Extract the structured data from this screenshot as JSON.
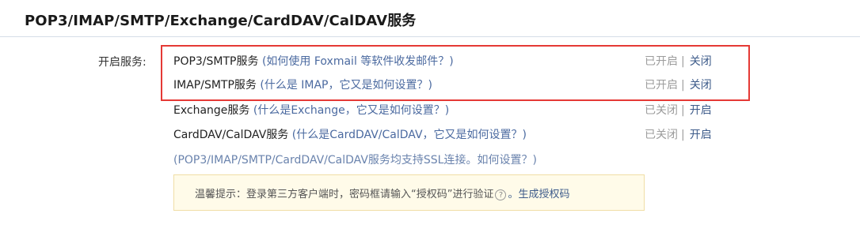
{
  "header": {
    "title": "POP3/IMAP/SMTP/Exchange/CardDAV/CalDAV服务"
  },
  "section_label": "开启服务:",
  "services": [
    {
      "name": "POP3/SMTP服务",
      "help": "(如何使用 Foxmail 等软件收发邮件？)",
      "status": "已开启",
      "separator": "|",
      "action": "关闭"
    },
    {
      "name": "IMAP/SMTP服务",
      "help": "(什么是 IMAP，它又是如何设置？)",
      "status": "已开启",
      "separator": "|",
      "action": "关闭"
    },
    {
      "name": "Exchange服务",
      "help": "(什么是Exchange，它又是如何设置？)",
      "status": "已关闭",
      "separator": "|",
      "action": "开启"
    },
    {
      "name": "CardDAV/CalDAV服务",
      "help": "(什么是CardDAV/CalDAV，它又是如何设置？)",
      "status": "已关闭",
      "separator": "|",
      "action": "开启"
    }
  ],
  "ssl_note": "(POP3/IMAP/SMTP/CardDAV/CalDAV服务均支持SSL连接。如何设置？)",
  "tip": {
    "text": "温馨提示：登录第三方客户端时，密码框请输入“授权码”进行验证",
    "help_icon": "?",
    "link": "。生成授权码"
  },
  "colors": {
    "highlight": "#e53935",
    "tip_background": "#fffbe9",
    "link": "#3d5b8a"
  }
}
